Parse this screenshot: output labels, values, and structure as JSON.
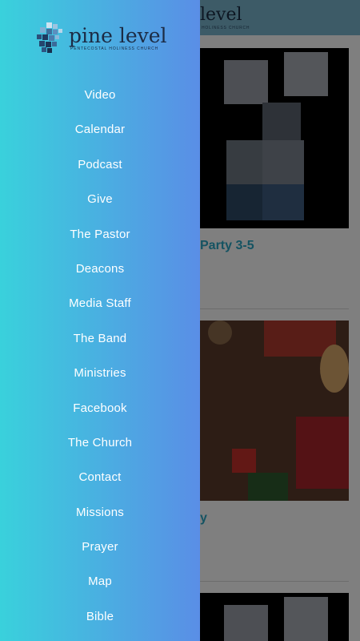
{
  "brand": {
    "name": "pine level",
    "tagline": "PENTECOSTAL HOLINESS CHURCH"
  },
  "background": {
    "header_logo": "level",
    "header_tagline": "HOLINESS CHURCH",
    "card1_title": "Party 3-5",
    "card2_title": "y"
  },
  "menu": {
    "items": [
      {
        "label": "Video"
      },
      {
        "label": "Calendar"
      },
      {
        "label": "Podcast"
      },
      {
        "label": "Give"
      },
      {
        "label": "The Pastor"
      },
      {
        "label": "Deacons"
      },
      {
        "label": "Media Staff"
      },
      {
        "label": "The Band"
      },
      {
        "label": "Ministries"
      },
      {
        "label": "Facebook"
      },
      {
        "label": "The Church"
      },
      {
        "label": "Contact"
      },
      {
        "label": "Missions"
      },
      {
        "label": "Prayer"
      },
      {
        "label": "Map"
      },
      {
        "label": "Bible"
      }
    ]
  },
  "colors": {
    "drawer_gradient_start": "#39d1dc",
    "drawer_gradient_end": "#5a8ee6",
    "card_title": "#2aa6c4"
  }
}
